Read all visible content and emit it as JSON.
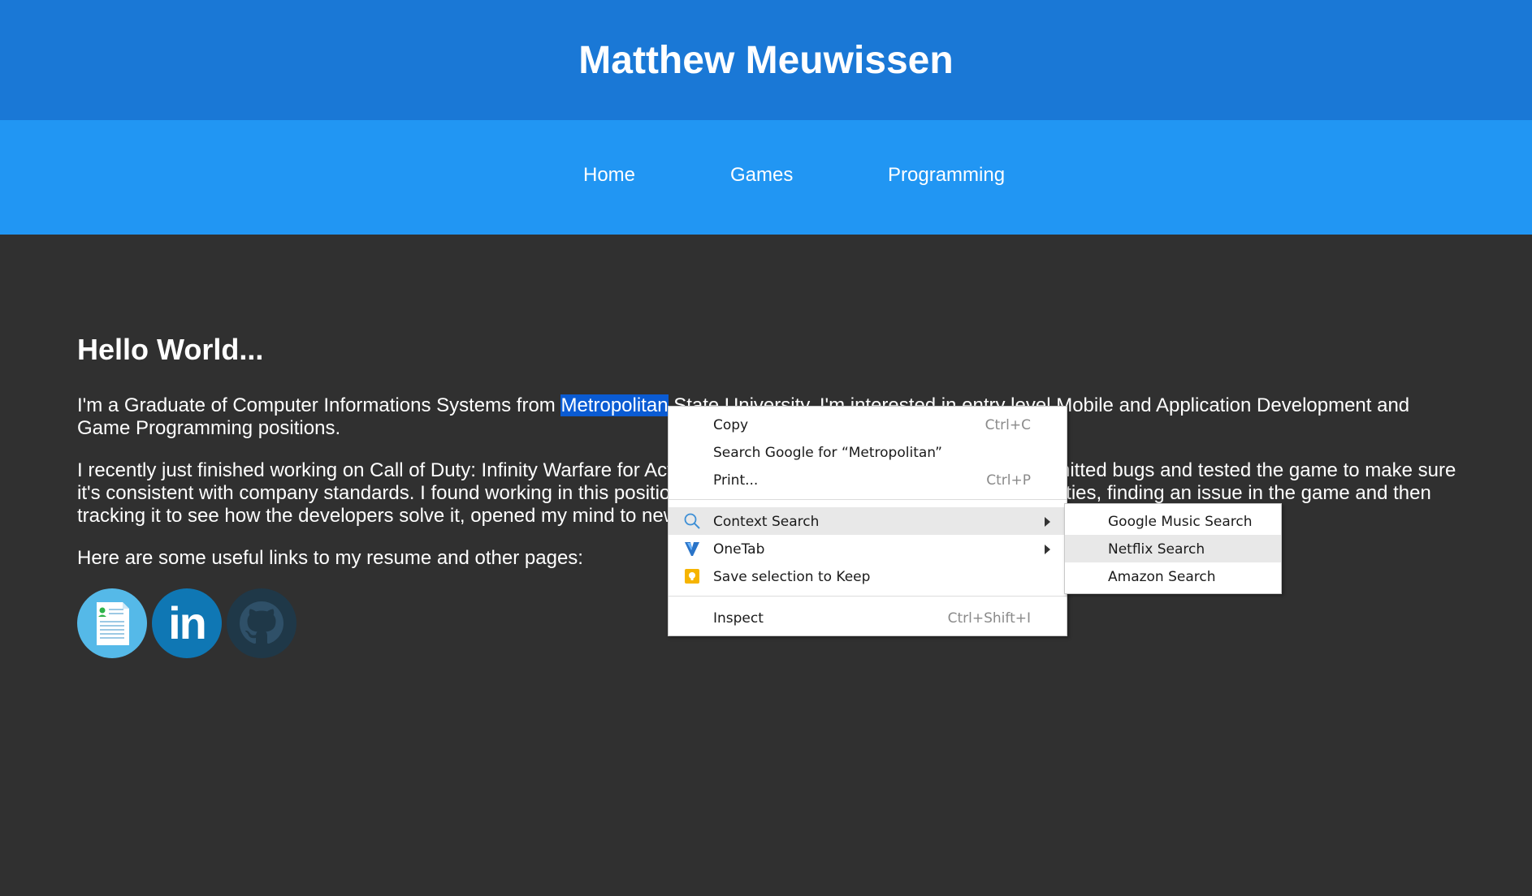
{
  "site": {
    "title": "Matthew Meuwissen"
  },
  "nav": {
    "items": [
      "Home",
      "Games",
      "Programming"
    ]
  },
  "main": {
    "heading": "Hello World...",
    "p1_before": "I'm a Graduate of Computer Informations Systems from ",
    "p1_selected": "Metropolitan",
    "p1_after": " State University. I'm interested in entry level Mobile and Application Development and Game Programming positions.",
    "p2": "I recently just finished working on Call of Duty: Infinity Warfare for Activision as a QA tester where I found and submitted bugs and tested the game to make sure it's consistent with company standards. I found working in this position helped me improve my problem solving abilities, finding an issue in the game and then tracking it to see how the developers solve it, opened my mind to new ways of thinking.",
    "p3": "Here are some useful links to my resume and other pages:"
  },
  "links": [
    {
      "icon": "resume-icon",
      "color": "#55b9e8"
    },
    {
      "icon": "linkedin-icon",
      "label": "in",
      "color": "#0f77b4"
    },
    {
      "icon": "github-icon",
      "color": "#1f3848"
    }
  ],
  "context_menu": {
    "copy": {
      "label": "Copy",
      "shortcut": "Ctrl+C"
    },
    "search_google": {
      "label": "Search Google for “Metropolitan”"
    },
    "print": {
      "label": "Print...",
      "shortcut": "Ctrl+P"
    },
    "context_search": {
      "label": "Context Search",
      "icon": "magnifier-icon"
    },
    "onetab": {
      "label": "OneTab",
      "icon": "onetab-icon"
    },
    "save_keep": {
      "label": "Save selection to Keep",
      "icon": "keep-icon"
    },
    "inspect": {
      "label": "Inspect",
      "shortcut": "Ctrl+Shift+I"
    }
  },
  "submenu": {
    "items": [
      "Google Music Search",
      "Netflix Search",
      "Amazon Search"
    ],
    "highlighted": "Netflix Search"
  },
  "colors": {
    "header": "#1a78d6",
    "nav": "#2196f3",
    "background": "#303030",
    "selection": "#0a5bd3"
  }
}
